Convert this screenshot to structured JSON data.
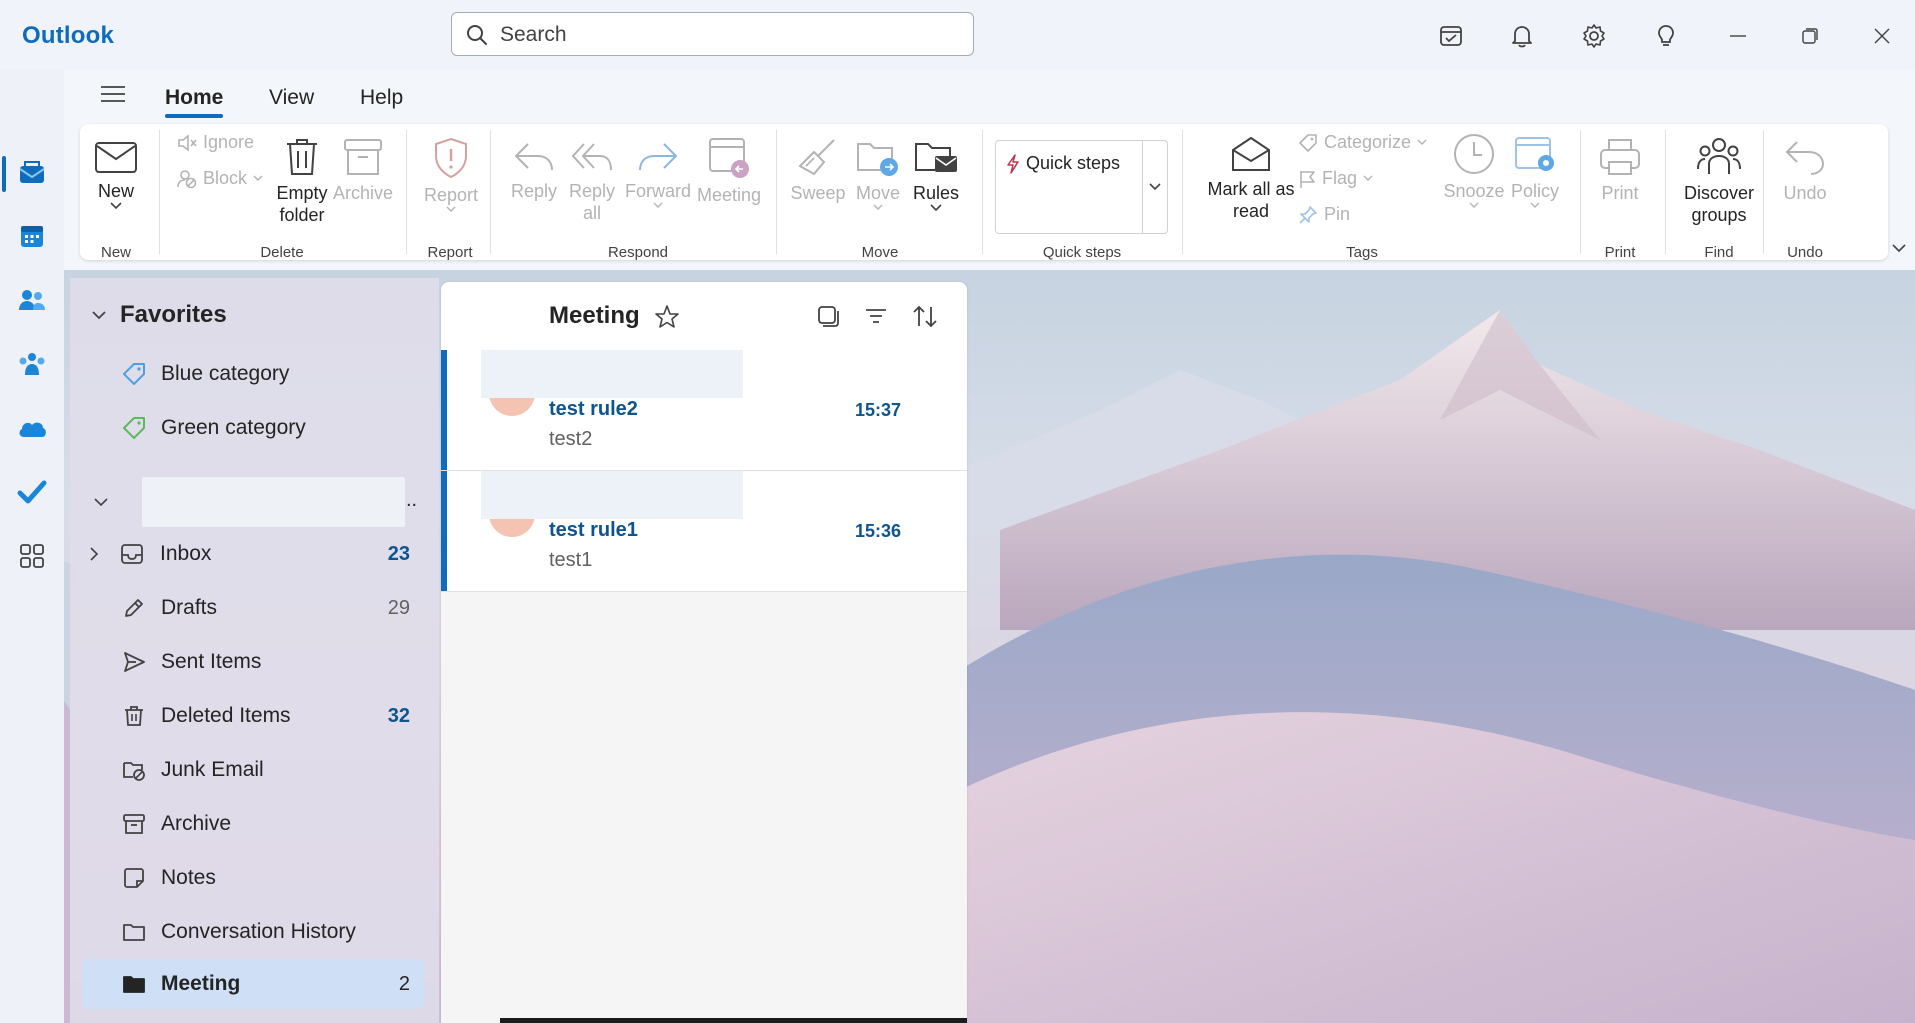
{
  "titlebar": {
    "app_name": "Outlook",
    "search_placeholder": "Search"
  },
  "menu": {
    "tabs": [
      {
        "label": "Home",
        "active": true
      },
      {
        "label": "View",
        "active": false
      },
      {
        "label": "Help",
        "active": false
      }
    ]
  },
  "ribbon": {
    "new": {
      "label": "New",
      "group": "New"
    },
    "delete": {
      "ignore": "Ignore",
      "block": "Block",
      "empty_folder": "Empty folder",
      "archive": "Archive",
      "group": "Delete"
    },
    "report": {
      "label": "Report",
      "group": "Report"
    },
    "respond": {
      "reply": "Reply",
      "reply_all": "Reply all",
      "forward": "Forward",
      "meeting": "Meeting",
      "group": "Respond"
    },
    "move": {
      "sweep": "Sweep",
      "move": "Move",
      "rules": "Rules",
      "group": "Move"
    },
    "quick_steps": {
      "label": "Quick steps",
      "group": "Quick steps"
    },
    "tags": {
      "mark_all_read": "Mark all as read",
      "categorize": "Categorize",
      "flag": "Flag",
      "pin": "Pin",
      "snooze": "Snooze",
      "policy": "Policy",
      "group": "Tags"
    },
    "print": {
      "label": "Print",
      "group": "Print"
    },
    "find": {
      "label": "Discover groups",
      "group": "Find"
    },
    "undo": {
      "label": "Undo",
      "group": "Undo"
    }
  },
  "folders": {
    "favorites_title": "Favorites",
    "favorites": [
      {
        "label": "Blue category",
        "color": "#4f9fe0"
      },
      {
        "label": "Green category",
        "color": "#5cb85c"
      }
    ],
    "account_more": "..",
    "items": [
      {
        "label": "Inbox",
        "count": "23",
        "count_style": "unread"
      },
      {
        "label": "Drafts",
        "count": "29",
        "count_style": "total"
      },
      {
        "label": "Sent Items",
        "count": "",
        "count_style": ""
      },
      {
        "label": "Deleted Items",
        "count": "32",
        "count_style": "unread"
      },
      {
        "label": "Junk Email",
        "count": "",
        "count_style": ""
      },
      {
        "label": "Archive",
        "count": "",
        "count_style": ""
      },
      {
        "label": "Notes",
        "count": "",
        "count_style": ""
      },
      {
        "label": "Conversation History",
        "count": "",
        "count_style": ""
      },
      {
        "label": "Meeting",
        "count": "2",
        "count_style": "total"
      }
    ]
  },
  "message_list": {
    "title": "Meeting",
    "messages": [
      {
        "subject": "test rule2",
        "preview": "test2",
        "time": "15:37"
      },
      {
        "subject": "test rule1",
        "preview": "test1",
        "time": "15:36"
      }
    ]
  },
  "colors": {
    "accent": "#0f6cbd",
    "unread_text": "#0f548c",
    "selected_folder": "#cfe0f6",
    "disabled_text": "#b3b3b3"
  }
}
